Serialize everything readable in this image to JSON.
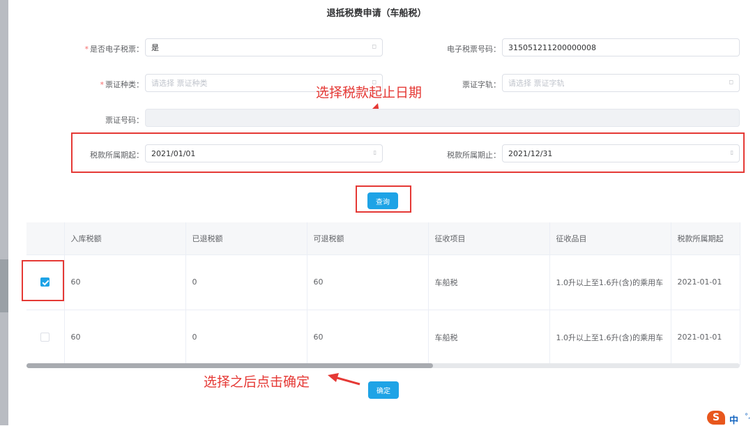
{
  "page": {
    "title": "退抵税费申请（车船税）"
  },
  "form": {
    "is_electronic": {
      "label": "是否电子税票",
      "value": "是",
      "required": "*"
    },
    "ticket_number": {
      "label": "电子税票号码",
      "value": "315051211200000008"
    },
    "ticket_type": {
      "label": "票证种类",
      "placeholder": "请选择 票证种类",
      "required": "*"
    },
    "ticket_track": {
      "label": "票证字轨",
      "placeholder": "请选择 票证字轨"
    },
    "ticket_code": {
      "label": "票证号码",
      "value": ""
    },
    "period_start": {
      "label": "税款所属期起",
      "value": "2021/01/01"
    },
    "period_end": {
      "label": "税款所属期止",
      "value": "2021/12/31"
    },
    "colon": "："
  },
  "buttons": {
    "query": "查询",
    "confirm": "确定"
  },
  "annotations": {
    "select_dates": "选择税款起止日期",
    "select_then_confirm": "选择之后点击确定"
  },
  "table": {
    "headers": [
      "入库税额",
      "已退税额",
      "可退税额",
      "征收项目",
      "征收品目",
      "税款所属期起"
    ],
    "rows": [
      {
        "checked": true,
        "cells": [
          "60",
          "0",
          "60",
          "车船税",
          "1.0升以上至1.6升(含)的乘用车",
          "2021-01-01"
        ]
      },
      {
        "checked": false,
        "cells": [
          "60",
          "0",
          "60",
          "车船税",
          "1.0升以上至1.6升(含)的乘用车",
          "2021-01-01"
        ]
      }
    ]
  },
  "ime": {
    "logo": "S",
    "mode": "中"
  },
  "colors": {
    "accent": "#1ea3e6",
    "annotation": "#e53935",
    "required": "#f56c6c"
  },
  "icons": {
    "select_suffix": "select-arrow-icon",
    "date_suffix": "calendar-icon"
  }
}
